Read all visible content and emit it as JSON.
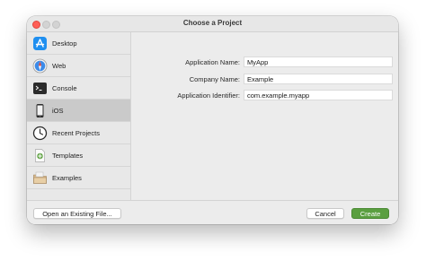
{
  "window": {
    "title": "Choose a Project"
  },
  "sidebar": {
    "items": [
      {
        "label": "Desktop",
        "icon": "app-store-icon",
        "selected": false
      },
      {
        "label": "Web",
        "icon": "safari-compass-icon",
        "selected": false
      },
      {
        "label": "Console",
        "icon": "terminal-icon",
        "selected": false
      },
      {
        "label": "iOS",
        "icon": "iphone-icon",
        "selected": true
      },
      {
        "label": "Recent Projects",
        "icon": "clock-icon",
        "selected": false
      },
      {
        "label": "Templates",
        "icon": "template-document-icon",
        "selected": false
      },
      {
        "label": "Examples",
        "icon": "folder-box-icon",
        "selected": false
      }
    ]
  },
  "form": {
    "fields": [
      {
        "label": "Application Name:",
        "value": "MyApp"
      },
      {
        "label": "Company Name:",
        "value": "Example"
      },
      {
        "label": "Application Identifier:",
        "value": "com.example.myapp"
      }
    ]
  },
  "footer": {
    "open_existing_label": "Open an Existing File...",
    "cancel_label": "Cancel",
    "create_label": "Create"
  },
  "colors": {
    "primary_button": "#5a9f40",
    "selected_row": "#cacaca",
    "close_button": "#fe5f57"
  }
}
